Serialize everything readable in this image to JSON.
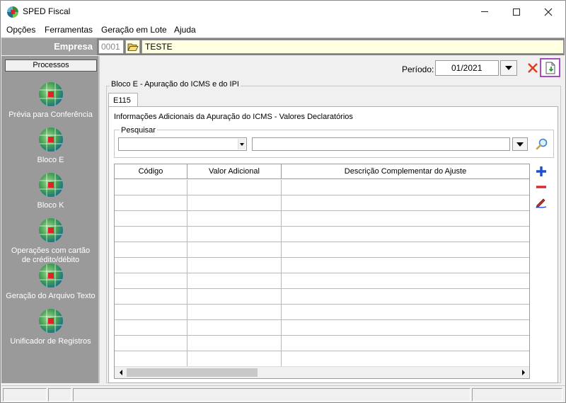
{
  "window": {
    "title": "SPED Fiscal"
  },
  "menu": [
    "Opções",
    "Ferramentas",
    "Geração em Lote",
    "Ajuda"
  ],
  "empresa": {
    "label": "Empresa",
    "code": "0001",
    "name": "TESTE"
  },
  "sidebar": {
    "header": "Processos",
    "items": [
      {
        "label_lines": [
          "Prévia para Conferência"
        ]
      },
      {
        "label_lines": [
          "Bloco E"
        ]
      },
      {
        "label_lines": [
          "Bloco K"
        ]
      },
      {
        "label_lines": [
          "Operações com cartão",
          "de crédito/débito"
        ]
      },
      {
        "label_lines": [
          "Geração do Arquivo Texto"
        ]
      },
      {
        "label_lines": [
          "Unificador de Registros"
        ]
      }
    ]
  },
  "periodo": {
    "label": "Período:",
    "value": "01/2021"
  },
  "group": {
    "title": "Bloco E - Apuração do ICMS e do IPI"
  },
  "tab": {
    "label": "E115"
  },
  "panel": {
    "title": "Informações Adicionais da Apuração do ICMS - Valores Declaratórios"
  },
  "search": {
    "legend": "Pesquisar",
    "field_value": "",
    "text_value": ""
  },
  "grid": {
    "columns": [
      "Código",
      "Valor Adicional",
      "Descrição Complementar do Ajuste"
    ],
    "rows": [
      [
        "",
        "",
        ""
      ],
      [
        "",
        "",
        ""
      ],
      [
        "",
        "",
        ""
      ],
      [
        "",
        "",
        ""
      ],
      [
        "",
        "",
        ""
      ],
      [
        "",
        "",
        ""
      ],
      [
        "",
        "",
        ""
      ],
      [
        "",
        "",
        ""
      ],
      [
        "",
        "",
        ""
      ],
      [
        "",
        "",
        ""
      ],
      [
        "",
        "",
        ""
      ],
      [
        "",
        "",
        ""
      ]
    ]
  },
  "icons": {
    "app": "sped-globe-icon",
    "folder": "folder-open-icon",
    "process": "sped-globe-icon",
    "cancel": "red-x-icon",
    "export": "document-download-icon",
    "search": "magnifier-icon",
    "add": "plus-icon",
    "remove": "minus-icon",
    "edit": "pencil-icon"
  },
  "colors": {
    "add": "#1f4fcf",
    "remove": "#d8262f",
    "cancel": "#e23a1f",
    "export_highlight": "#a64ec0",
    "sidebar": "#9a9a9a",
    "empresa_label": "#a0a0a0"
  }
}
